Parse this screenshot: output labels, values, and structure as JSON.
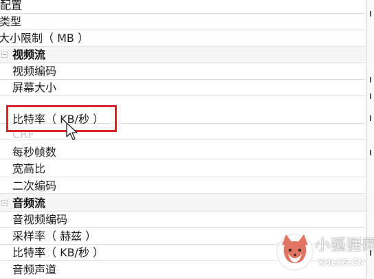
{
  "property_grid": {
    "rows": [
      {
        "label": "配置",
        "type": "item"
      },
      {
        "label": "类型",
        "type": "item"
      },
      {
        "label": "大小限制（ MB ）",
        "type": "item"
      },
      {
        "label": "视频流",
        "type": "group"
      },
      {
        "label": "视频编码",
        "type": "item"
      },
      {
        "label": "屏幕大小",
        "type": "item"
      },
      {
        "label": "比特率（ KB/秒 ）",
        "type": "item",
        "highlighted": true
      },
      {
        "label": "CRF",
        "type": "item",
        "disabled": true
      },
      {
        "label": "每秒帧数",
        "type": "item"
      },
      {
        "label": "宽高比",
        "type": "item"
      },
      {
        "label": "二次编码",
        "type": "item"
      },
      {
        "label": "音频流",
        "type": "group"
      },
      {
        "label": "音视频编码",
        "type": "item"
      },
      {
        "label": "采样率（ 赫兹 ）",
        "type": "item"
      },
      {
        "label": "比特率（ KB/秒 ）",
        "type": "item"
      },
      {
        "label": "音频声道",
        "type": "item"
      }
    ]
  },
  "highlight": {
    "color": "#d8232a"
  },
  "watermark": {
    "text_cn": "小狐狸网",
    "text_en": "XHLKS.CN",
    "logo_icon": "fox-logo-icon"
  },
  "colors": {
    "row_border": "#e2e2e2",
    "group_background": "#f5f5f5",
    "disabled_text": "#c9c9c9",
    "text": "#1e1e1e"
  }
}
